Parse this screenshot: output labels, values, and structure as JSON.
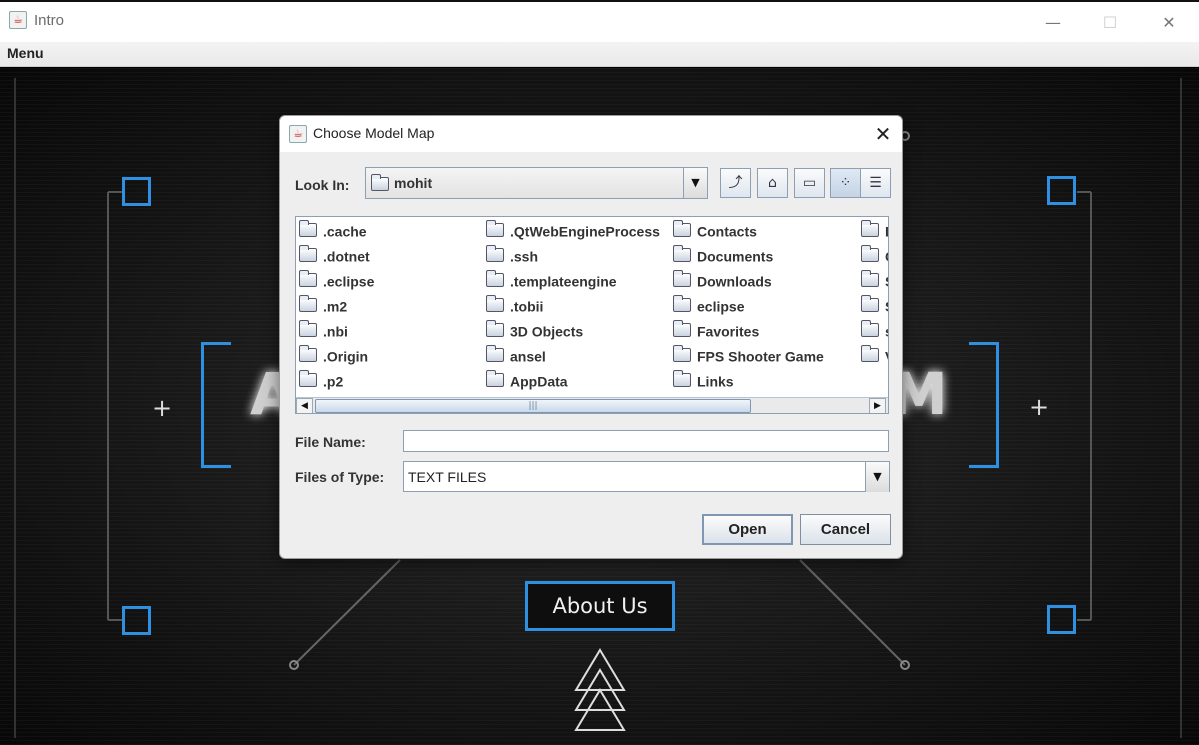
{
  "window": {
    "title": "Intro",
    "minimize_glyph": "—",
    "maximize_glyph": "☐",
    "close_glyph": "✕"
  },
  "menubar": {
    "items": [
      {
        "label": "Menu"
      }
    ]
  },
  "scene": {
    "plus_glyph": "+",
    "heading_left_partial": "A",
    "heading_right_partial": "M",
    "about_button_label": "About Us"
  },
  "dialog": {
    "title": "Choose Model Map",
    "close_glyph": "✕",
    "look_in_label": "Look In:",
    "look_in_value": "mohit",
    "toolbar": {
      "up_icon": "up-folder-icon",
      "home_icon": "home-icon",
      "new_folder_icon": "new-folder-icon",
      "list_view_icon": "list-view-icon",
      "details_view_icon": "details-view-icon"
    },
    "files": {
      "col1": [
        ".cache",
        ".dotnet",
        ".eclipse",
        ".m2",
        ".nbi",
        ".Origin",
        ".p2"
      ],
      "col2": [
        ".QtWebEngineProcess",
        ".ssh",
        ".templateengine",
        ".tobii",
        "3D Objects",
        "ansel",
        "AppData"
      ],
      "col3": [
        "Contacts",
        "Documents",
        "Downloads",
        "eclipse",
        "Favorites",
        "FPS Shooter Game",
        "Links"
      ],
      "col4": [
        "I",
        "C",
        "S",
        "S",
        "s",
        "V",
        ""
      ]
    },
    "file_name_label": "File Name:",
    "file_name_value": "",
    "files_of_type_label": "Files of Type:",
    "files_of_type_value": "TEXT FILES",
    "open_label": "Open",
    "cancel_label": "Cancel"
  }
}
